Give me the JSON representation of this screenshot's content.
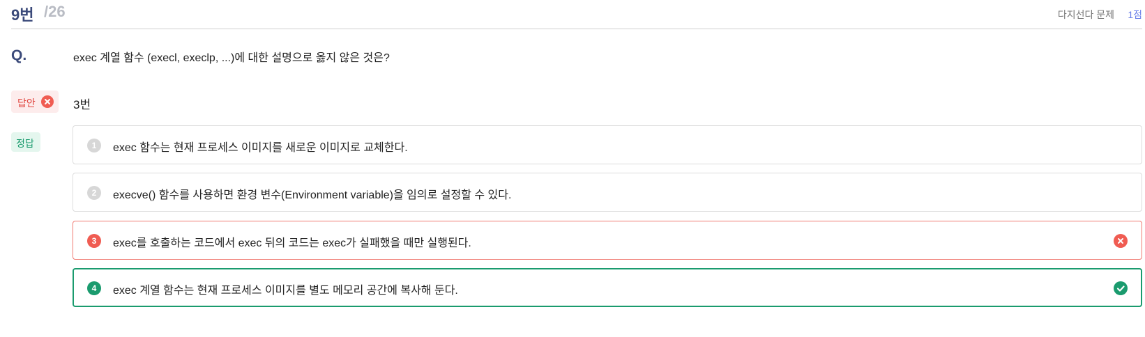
{
  "header": {
    "question_number": "9번",
    "total": "/26",
    "question_type": "다지선다 문제",
    "score": "1점"
  },
  "question": {
    "label": "Q.",
    "text": "exec 계열 함수 (execl, execlp, ...)에 대한 설명으로 옳지 않은 것은?"
  },
  "my_answer": {
    "label": "답안",
    "value": "3번",
    "status_icon": "x-circle-icon"
  },
  "correct_answer": {
    "label": "정답"
  },
  "options": [
    {
      "number": "1",
      "text": "exec 함수는 현재 프로세스 이미지를 새로운 이미지로 교체한다.",
      "state": "normal"
    },
    {
      "number": "2",
      "text": "execve() 함수를 사용하면 환경 변수(Environment variable)을 임의로 설정할 수 있다.",
      "state": "normal"
    },
    {
      "number": "3",
      "text": "exec를 호출하는 코드에서 exec 뒤의 코드는 exec가 실패했을 때만 실행된다.",
      "state": "wrong"
    },
    {
      "number": "4",
      "text": "exec 계열 함수는 현재 프로세스 이미지를 별도 메모리 공간에 복사해 둔다.",
      "state": "correct"
    }
  ],
  "colors": {
    "navy": "#3b4a7a",
    "red": "#f05c52",
    "green": "#1a9b6e",
    "accent_blue": "#6a7fe8"
  }
}
